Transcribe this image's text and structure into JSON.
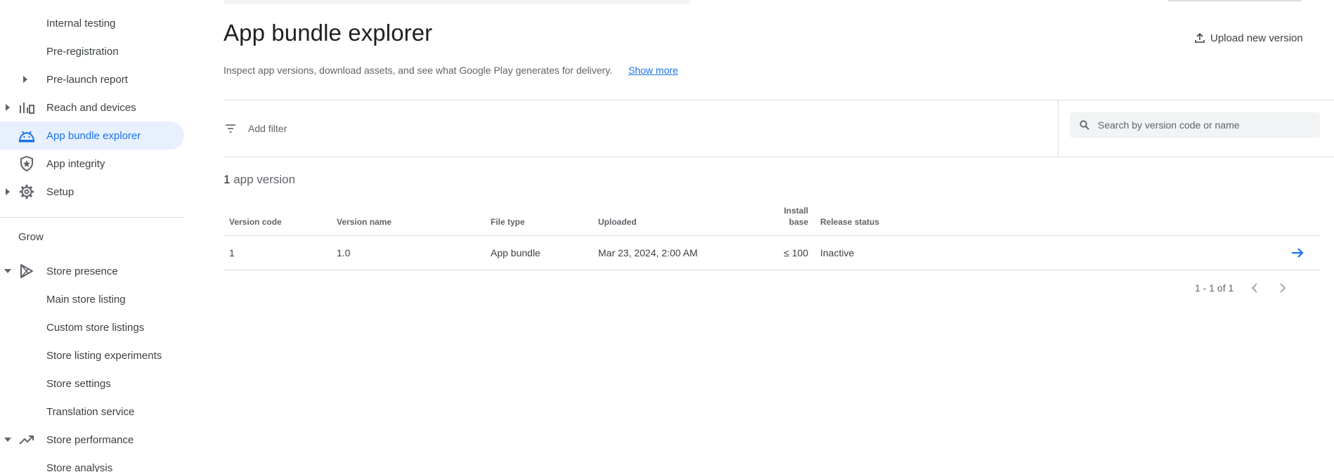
{
  "sidebar": {
    "items": [
      {
        "label": "Internal testing"
      },
      {
        "label": "Pre-registration"
      },
      {
        "label": "Pre-launch report"
      },
      {
        "label": "Reach and devices"
      },
      {
        "label": "App bundle explorer"
      },
      {
        "label": "App integrity"
      },
      {
        "label": "Setup"
      }
    ],
    "grow_header": "Grow",
    "grow_items": [
      {
        "label": "Store presence"
      },
      {
        "label": "Main store listing"
      },
      {
        "label": "Custom store listings"
      },
      {
        "label": "Store listing experiments"
      },
      {
        "label": "Store settings"
      },
      {
        "label": "Translation service"
      },
      {
        "label": "Store performance"
      },
      {
        "label": "Store analysis"
      }
    ]
  },
  "header": {
    "title": "App bundle explorer",
    "upload_label": "Upload new version",
    "description": "Inspect app versions, download assets, and see what Google Play generates for delivery.",
    "show_more": "Show more"
  },
  "filter": {
    "add_filter_label": "Add filter",
    "search_placeholder": "Search by version code or name"
  },
  "summary": {
    "count": "1",
    "count_suffix": " app version"
  },
  "table": {
    "columns": [
      {
        "label": "Version code"
      },
      {
        "label": "Version name"
      },
      {
        "label": "File type"
      },
      {
        "label": "Uploaded"
      },
      {
        "label": "Install",
        "label2": "base"
      },
      {
        "label": "Release status"
      }
    ],
    "rows": [
      {
        "version_code": "1",
        "version_name": "1.0",
        "file_type": "App bundle",
        "uploaded": "Mar 23, 2024, 2:00 AM",
        "install_base": "≤ 100",
        "release_status": "Inactive"
      }
    ]
  },
  "pagination": {
    "range": "1 - 1 of 1"
  },
  "colors": {
    "accent": "#1a73e8",
    "active_bg": "#e8f0fe"
  },
  "icons": {
    "reach": "bar-chart-icon",
    "bundle": "android-icon",
    "integrity": "shield-icon",
    "setup": "gear-icon",
    "store_presence": "play-icon",
    "store_performance": "trending-up-icon",
    "upload": "upload-icon",
    "filter": "filter-icon",
    "search": "search-icon",
    "row_arrow": "arrow-right-icon"
  }
}
